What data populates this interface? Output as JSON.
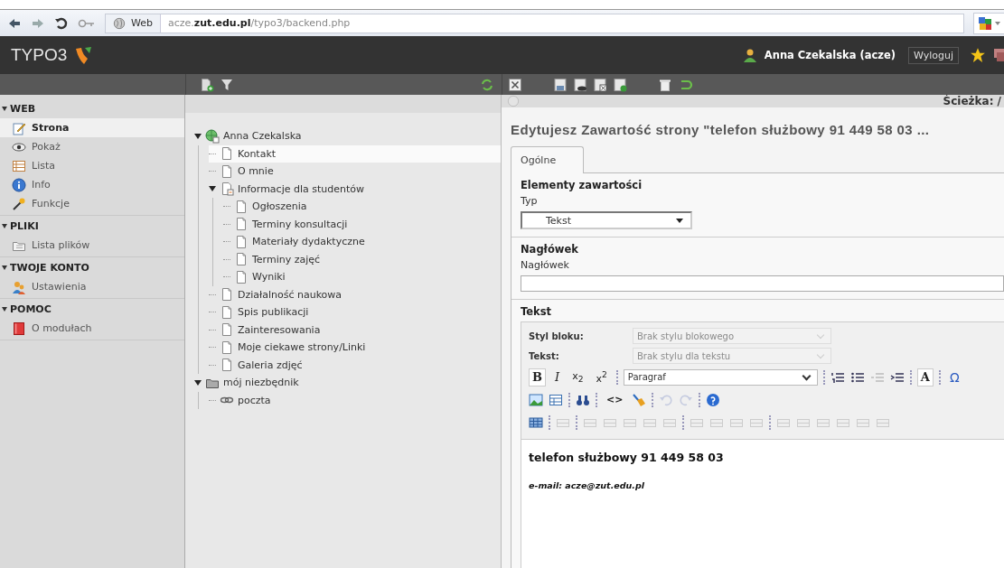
{
  "browser": {
    "site_label": "Web",
    "url": "acze.**zut.edu.pl**/typo3/backend.php"
  },
  "header": {
    "logo": "TYPO3",
    "user": "Anna Czekalska (acze)",
    "logout": "Wyloguj"
  },
  "modules": [
    {
      "title": "WEB",
      "expanded": true,
      "items": [
        {
          "label": "Strona",
          "kind": "edit",
          "selected": true
        },
        {
          "label": "Pokaż",
          "kind": "view",
          "selected": false
        },
        {
          "label": "Lista",
          "kind": "list",
          "selected": false
        },
        {
          "label": "Info",
          "kind": "info",
          "selected": false
        },
        {
          "label": "Funkcje",
          "kind": "wand",
          "selected": false
        }
      ]
    },
    {
      "title": "PLIKI",
      "expanded": true,
      "items": [
        {
          "label": "Lista plików",
          "kind": "files",
          "selected": false
        }
      ]
    },
    {
      "title": "TWOJE KONTO",
      "expanded": true,
      "items": [
        {
          "label": "Ustawienia",
          "kind": "users",
          "selected": false
        }
      ]
    },
    {
      "title": "POMOC",
      "expanded": true,
      "items": [
        {
          "label": "O modułach",
          "kind": "book",
          "selected": false
        }
      ]
    }
  ],
  "tree": [
    {
      "label": "Anna Czekalska",
      "kind": "site",
      "expanded": true,
      "selected": false,
      "children": [
        {
          "label": "Kontakt",
          "kind": "page",
          "selected": true
        },
        {
          "label": "O mnie",
          "kind": "page",
          "selected": false
        },
        {
          "label": "Informacje dla studentów",
          "kind": "pagefolder",
          "expanded": true,
          "selected": false,
          "children": [
            {
              "label": "Ogłoszenia",
              "kind": "page",
              "selected": false
            },
            {
              "label": "Terminy konsultacji",
              "kind": "page",
              "selected": false
            },
            {
              "label": "Materiały dydaktyczne",
              "kind": "page",
              "selected": false
            },
            {
              "label": "Terminy zajęć",
              "kind": "page",
              "selected": false
            },
            {
              "label": "Wyniki",
              "kind": "page",
              "selected": false
            }
          ]
        },
        {
          "label": "Działalność naukowa",
          "kind": "page",
          "selected": false
        },
        {
          "label": "Spis publikacji",
          "kind": "page",
          "selected": false
        },
        {
          "label": "Zainteresowania",
          "kind": "page",
          "selected": false
        },
        {
          "label": "Moje ciekawe strony/Linki",
          "kind": "page",
          "selected": false
        },
        {
          "label": "Galeria zdjęć",
          "kind": "page",
          "selected": false
        }
      ]
    },
    {
      "label": "mój niezbędnik",
      "kind": "folder",
      "expanded": true,
      "selected": false,
      "children": [
        {
          "label": "poczta",
          "kind": "link",
          "selected": false
        }
      ]
    }
  ],
  "content": {
    "path_label": "Ścieżka: /",
    "title": "Edytujesz Zawartość strony \"telefon służbowy 91 449 58 03 ...",
    "tabs": [
      {
        "label": "Ogólne",
        "selected": true
      }
    ],
    "sections": [
      {
        "title": "Elementy zawartości",
        "kind": "select",
        "field_label": "Typ",
        "value": "Tekst"
      },
      {
        "title": "Nagłówek",
        "kind": "input",
        "field_label": "Nagłówek"
      },
      {
        "title": "Tekst",
        "kind": "rte"
      }
    ],
    "editor": {
      "style_rows": [
        {
          "label": "Styl bloku:",
          "placeholder": "Brak stylu blokowego",
          "disabled": true
        },
        {
          "label": "Tekst:",
          "placeholder": "Brak stylu dla tekstu",
          "disabled": true
        }
      ],
      "format_buttons": [
        {
          "label": "B",
          "kind": "bold"
        },
        {
          "label": "I",
          "kind": "italic"
        },
        {
          "label": "x$_{2}$",
          "kind": "plain"
        },
        {
          "label": "x$^{2}$",
          "kind": "plain"
        }
      ],
      "block_format": "Paragraf",
      "color_button": "A",
      "symbol_button": "Ω",
      "code_button": "<>",
      "body": [
        {
          "kind": "heading",
          "text": "telefon służbowy 91 449 58 03"
        },
        {
          "kind": "note",
          "text": "e-mail: acze@zut.edu.pl"
        }
      ]
    }
  }
}
